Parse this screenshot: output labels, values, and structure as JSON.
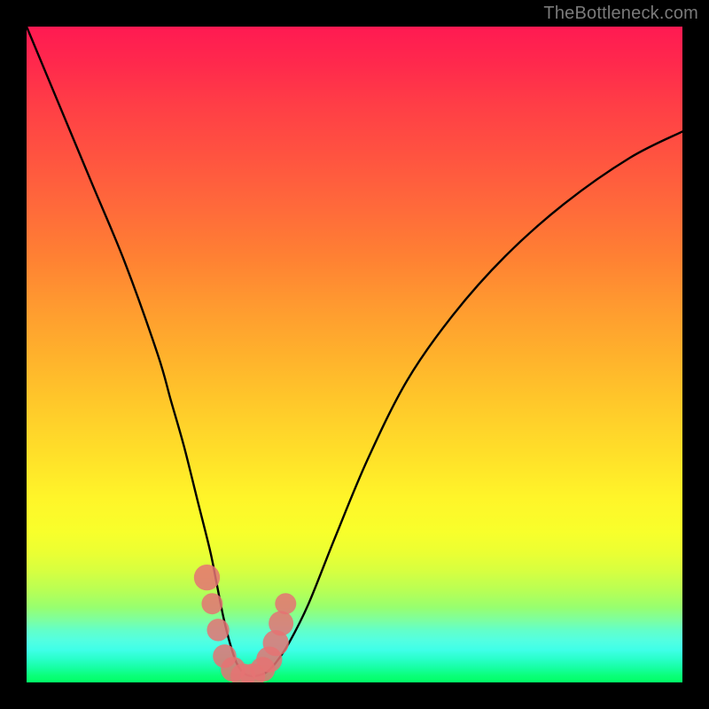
{
  "watermark": "TheBottleneck.com",
  "chart_data": {
    "type": "line",
    "title": "",
    "xlabel": "",
    "ylabel": "",
    "xlim": [
      0,
      100
    ],
    "ylim": [
      0,
      100
    ],
    "grid": false,
    "legend": false,
    "series": [
      {
        "name": "bottleneck-curve",
        "x": [
          0,
          5,
          10,
          15,
          20,
          22,
          24,
          26,
          28,
          29,
          30,
          31,
          32,
          33,
          34,
          35,
          36.5,
          38,
          40,
          43,
          47,
          52,
          58,
          65,
          73,
          82,
          92,
          100
        ],
        "values": [
          100,
          88,
          76,
          64,
          50,
          43,
          36,
          28,
          20,
          15,
          10,
          6,
          3,
          1.5,
          1,
          1,
          1.5,
          3,
          6,
          12,
          22,
          34,
          46,
          56,
          65,
          73,
          80,
          84
        ]
      }
    ],
    "markers": [
      {
        "x": 27.5,
        "y": 16,
        "r": 1.6
      },
      {
        "x": 28.3,
        "y": 12,
        "r": 1.2
      },
      {
        "x": 29.2,
        "y": 8,
        "r": 1.3
      },
      {
        "x": 30.2,
        "y": 4,
        "r": 1.4
      },
      {
        "x": 31.5,
        "y": 2,
        "r": 1.5
      },
      {
        "x": 33.0,
        "y": 1,
        "r": 1.5
      },
      {
        "x": 34.5,
        "y": 1,
        "r": 1.5
      },
      {
        "x": 36.0,
        "y": 2,
        "r": 1.5
      },
      {
        "x": 37.0,
        "y": 3.5,
        "r": 1.6
      },
      {
        "x": 38.0,
        "y": 6,
        "r": 1.6
      },
      {
        "x": 38.8,
        "y": 9,
        "r": 1.5
      },
      {
        "x": 39.5,
        "y": 12,
        "r": 1.2
      }
    ],
    "colors": {
      "curve": "#000000",
      "marker_fill": "#e57373",
      "marker_stroke": "#e57373"
    }
  }
}
